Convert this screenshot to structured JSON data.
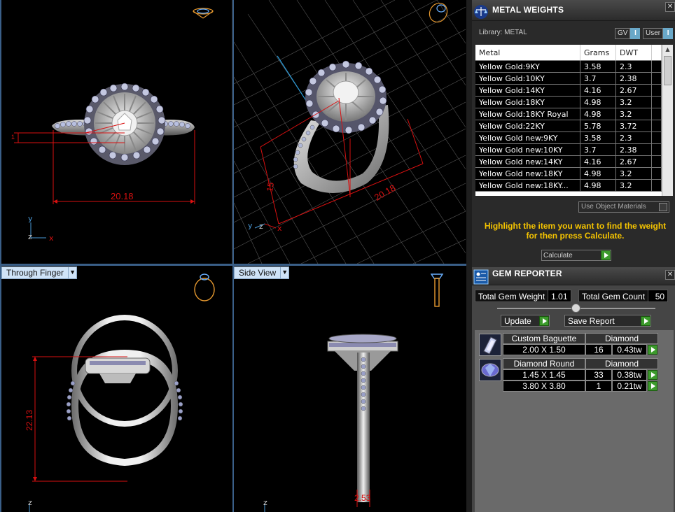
{
  "viewports": {
    "top_left": {
      "dimension_label": "20.18"
    },
    "top_right": {
      "dimension_label_a": "20.18",
      "dimension_label_b": "15"
    },
    "bottom_left": {
      "view_mode": "Through Finger",
      "dimension_label": "22.13"
    },
    "bottom_right": {
      "view_mode": "Side View",
      "dimension_label": "2.53"
    },
    "axes": {
      "y": "y",
      "z": "z",
      "x": "x"
    }
  },
  "metal_weights": {
    "title": "METAL WEIGHTS",
    "library_label": "Library: METAL",
    "toggle_gv": "GV",
    "toggle_user": "User",
    "toggle_mark": "I",
    "columns": [
      "Metal",
      "Grams",
      "DWT"
    ],
    "rows": [
      {
        "metal": "Yellow Gold:9KY",
        "grams": "3.58",
        "dwt": "2.3"
      },
      {
        "metal": "Yellow Gold:10KY",
        "grams": "3.7",
        "dwt": "2.38"
      },
      {
        "metal": "Yellow Gold:14KY",
        "grams": "4.16",
        "dwt": "2.67"
      },
      {
        "metal": "Yellow Gold:18KY",
        "grams": "4.98",
        "dwt": "3.2"
      },
      {
        "metal": "Yellow Gold:18KY Royal",
        "grams": "4.98",
        "dwt": "3.2"
      },
      {
        "metal": "Yellow Gold:22KY",
        "grams": "5.78",
        "dwt": "3.72"
      },
      {
        "metal": "Yellow Gold new:9KY",
        "grams": "3.58",
        "dwt": "2.3"
      },
      {
        "metal": "Yellow Gold new:10KY",
        "grams": "3.7",
        "dwt": "2.38"
      },
      {
        "metal": "Yellow Gold new:14KY",
        "grams": "4.16",
        "dwt": "2.67"
      },
      {
        "metal": "Yellow Gold new:18KY",
        "grams": "4.98",
        "dwt": "3.2"
      },
      {
        "metal": "Yellow Gold new:18KY...",
        "grams": "4.98",
        "dwt": "3.2"
      }
    ],
    "use_object_materials": "Use Object Materials",
    "hint": "Highlight the item you want to find the weight for then press Calculate.",
    "calculate_label": "Calculate"
  },
  "gem_reporter": {
    "title": "GEM REPORTER",
    "total_weight_label": "Total Gem Weight",
    "total_weight_value": "1.01",
    "total_count_label": "Total Gem Count",
    "total_count_value": "50",
    "update_label": "Update",
    "save_report_label": "Save Report",
    "groups": [
      {
        "shape": "Custom Baguette",
        "material": "Diamond",
        "icon": "baguette-gem-icon",
        "rows": [
          {
            "size": "2.00 X 1.50",
            "count": "16",
            "weight": "0.43tw"
          }
        ]
      },
      {
        "shape": "Diamond Round",
        "material": "Diamond",
        "icon": "round-gem-icon",
        "rows": [
          {
            "size": "1.45 X 1.45",
            "count": "33",
            "weight": "0.38tw"
          },
          {
            "size": "3.80 X 3.80",
            "count": "1",
            "weight": "0.21tw"
          }
        ]
      }
    ]
  },
  "colors": {
    "accent_yellow": "#f5c400",
    "dimension_red": "#d81010",
    "play_green": "#3c9a2c",
    "split_blue": "#3a5f88"
  }
}
